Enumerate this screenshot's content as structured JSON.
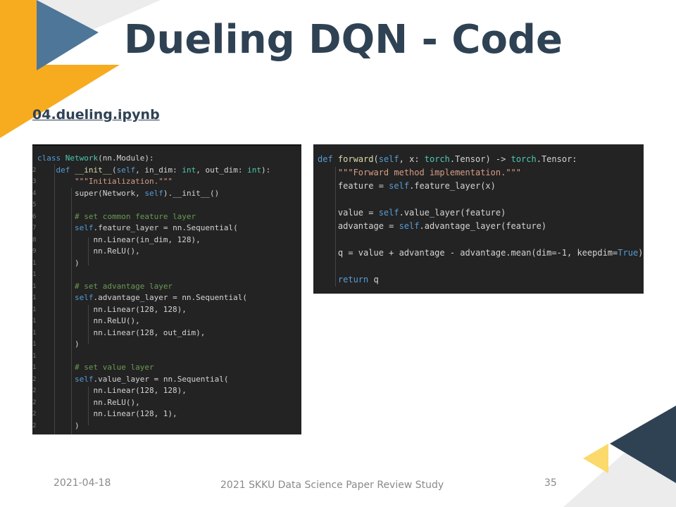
{
  "slide": {
    "title": "Dueling DQN - Code",
    "filename": "04.dueling.ipynb",
    "date": "2021-04-18",
    "footer": "2021 SKKU Data Science Paper Review Study",
    "page_number": "35"
  },
  "colors": {
    "accent_orange": "#f7ab1f",
    "accent_blue": "#4e7699",
    "accent_navy": "#2f4254",
    "accent_yellow": "#fbd96a",
    "code_bg": "#232323"
  },
  "code_left": {
    "gutter": [
      "",
      "2",
      "3",
      "4",
      "5",
      "6",
      "7",
      "8",
      "9",
      "10",
      "11",
      "12",
      "13",
      "14",
      "15",
      "16",
      "17",
      "18",
      "19",
      "20",
      "21",
      "22",
      "23",
      "24"
    ],
    "lines": [
      "class Network(nn.Module):",
      "    def __init__(self, in_dim: int, out_dim: int):",
      "        \"\"\"Initialization.\"\"\"",
      "        super(Network, self).__init__()",
      "",
      "        # set common feature layer",
      "        self.feature_layer = nn.Sequential(",
      "            nn.Linear(in_dim, 128),",
      "            nn.ReLU(),",
      "        )",
      "",
      "        # set advantage layer",
      "        self.advantage_layer = nn.Sequential(",
      "            nn.Linear(128, 128),",
      "            nn.ReLU(),",
      "            nn.Linear(128, out_dim),",
      "        )",
      "",
      "        # set value layer",
      "        self.value_layer = nn.Sequential(",
      "            nn.Linear(128, 128),",
      "            nn.ReLU(),",
      "            nn.Linear(128, 1),",
      "        )"
    ]
  },
  "code_right": {
    "lines": [
      "def forward(self, x: torch.Tensor) -> torch.Tensor:",
      "    \"\"\"Forward method implementation.\"\"\"",
      "    feature = self.feature_layer(x)",
      "",
      "    value = self.value_layer(feature)",
      "    advantage = self.advantage_layer(feature)",
      "",
      "    q = value + advantage - advantage.mean(dim=-1, keepdim=True)",
      "",
      "    return q"
    ]
  }
}
